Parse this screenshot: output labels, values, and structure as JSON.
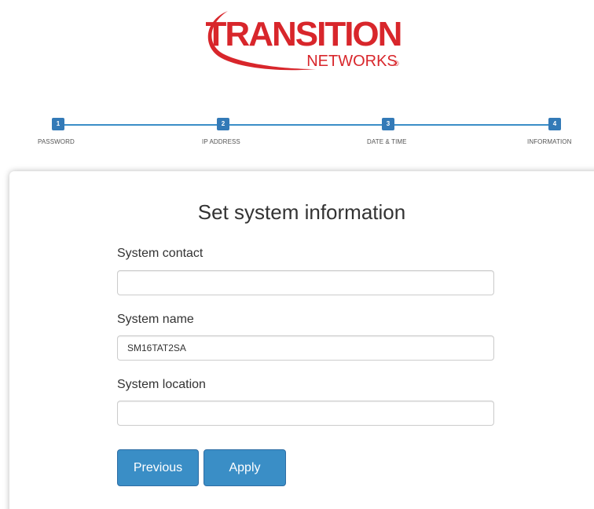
{
  "brand": {
    "name_line1": "TRANSITION",
    "name_line2": "NETWORKS",
    "registered": "®",
    "colors": {
      "red": "#d8262b",
      "blue": "#337ab7"
    }
  },
  "wizard": {
    "steps": [
      {
        "number": "1",
        "label": "PASSWORD"
      },
      {
        "number": "2",
        "label": "IP ADDRESS"
      },
      {
        "number": "3",
        "label": "DATE & TIME"
      },
      {
        "number": "4",
        "label": "INFORMATION"
      }
    ],
    "current_step": 4
  },
  "form": {
    "title": "Set system information",
    "fields": {
      "contact": {
        "label": "System contact",
        "value": ""
      },
      "name": {
        "label": "System name",
        "value": "SM16TAT2SA"
      },
      "location": {
        "label": "System location",
        "value": ""
      }
    },
    "buttons": {
      "previous": "Previous",
      "apply": "Apply"
    }
  }
}
